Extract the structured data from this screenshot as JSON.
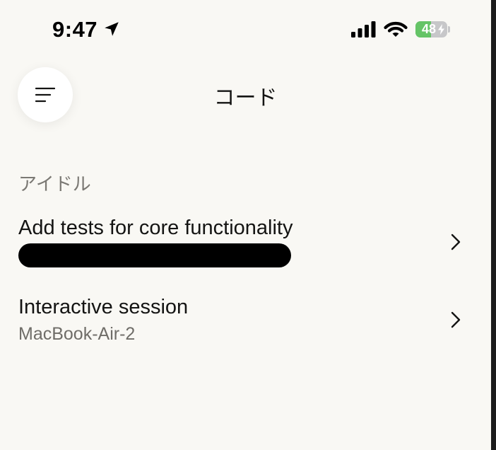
{
  "status_bar": {
    "time": "9:47",
    "battery_level": "48",
    "battery_percent": 48,
    "icons": [
      "location-arrow-icon",
      "cellular-signal-icon",
      "wifi-icon",
      "battery-charging-icon"
    ]
  },
  "header": {
    "menu_icon": "menu-lines-icon",
    "title": "コード"
  },
  "section": {
    "label": "アイドル"
  },
  "sessions": [
    {
      "title": "Add tests for core functionality",
      "subtitle": "",
      "subtitle_redacted": true
    },
    {
      "title": "Interactive session",
      "subtitle": "MacBook-Air-2",
      "subtitle_redacted": false
    }
  ],
  "colors": {
    "background": "#f9f8f4",
    "battery_green": "#65c466",
    "text_primary": "#141413",
    "text_secondary": "#6f6d68"
  }
}
